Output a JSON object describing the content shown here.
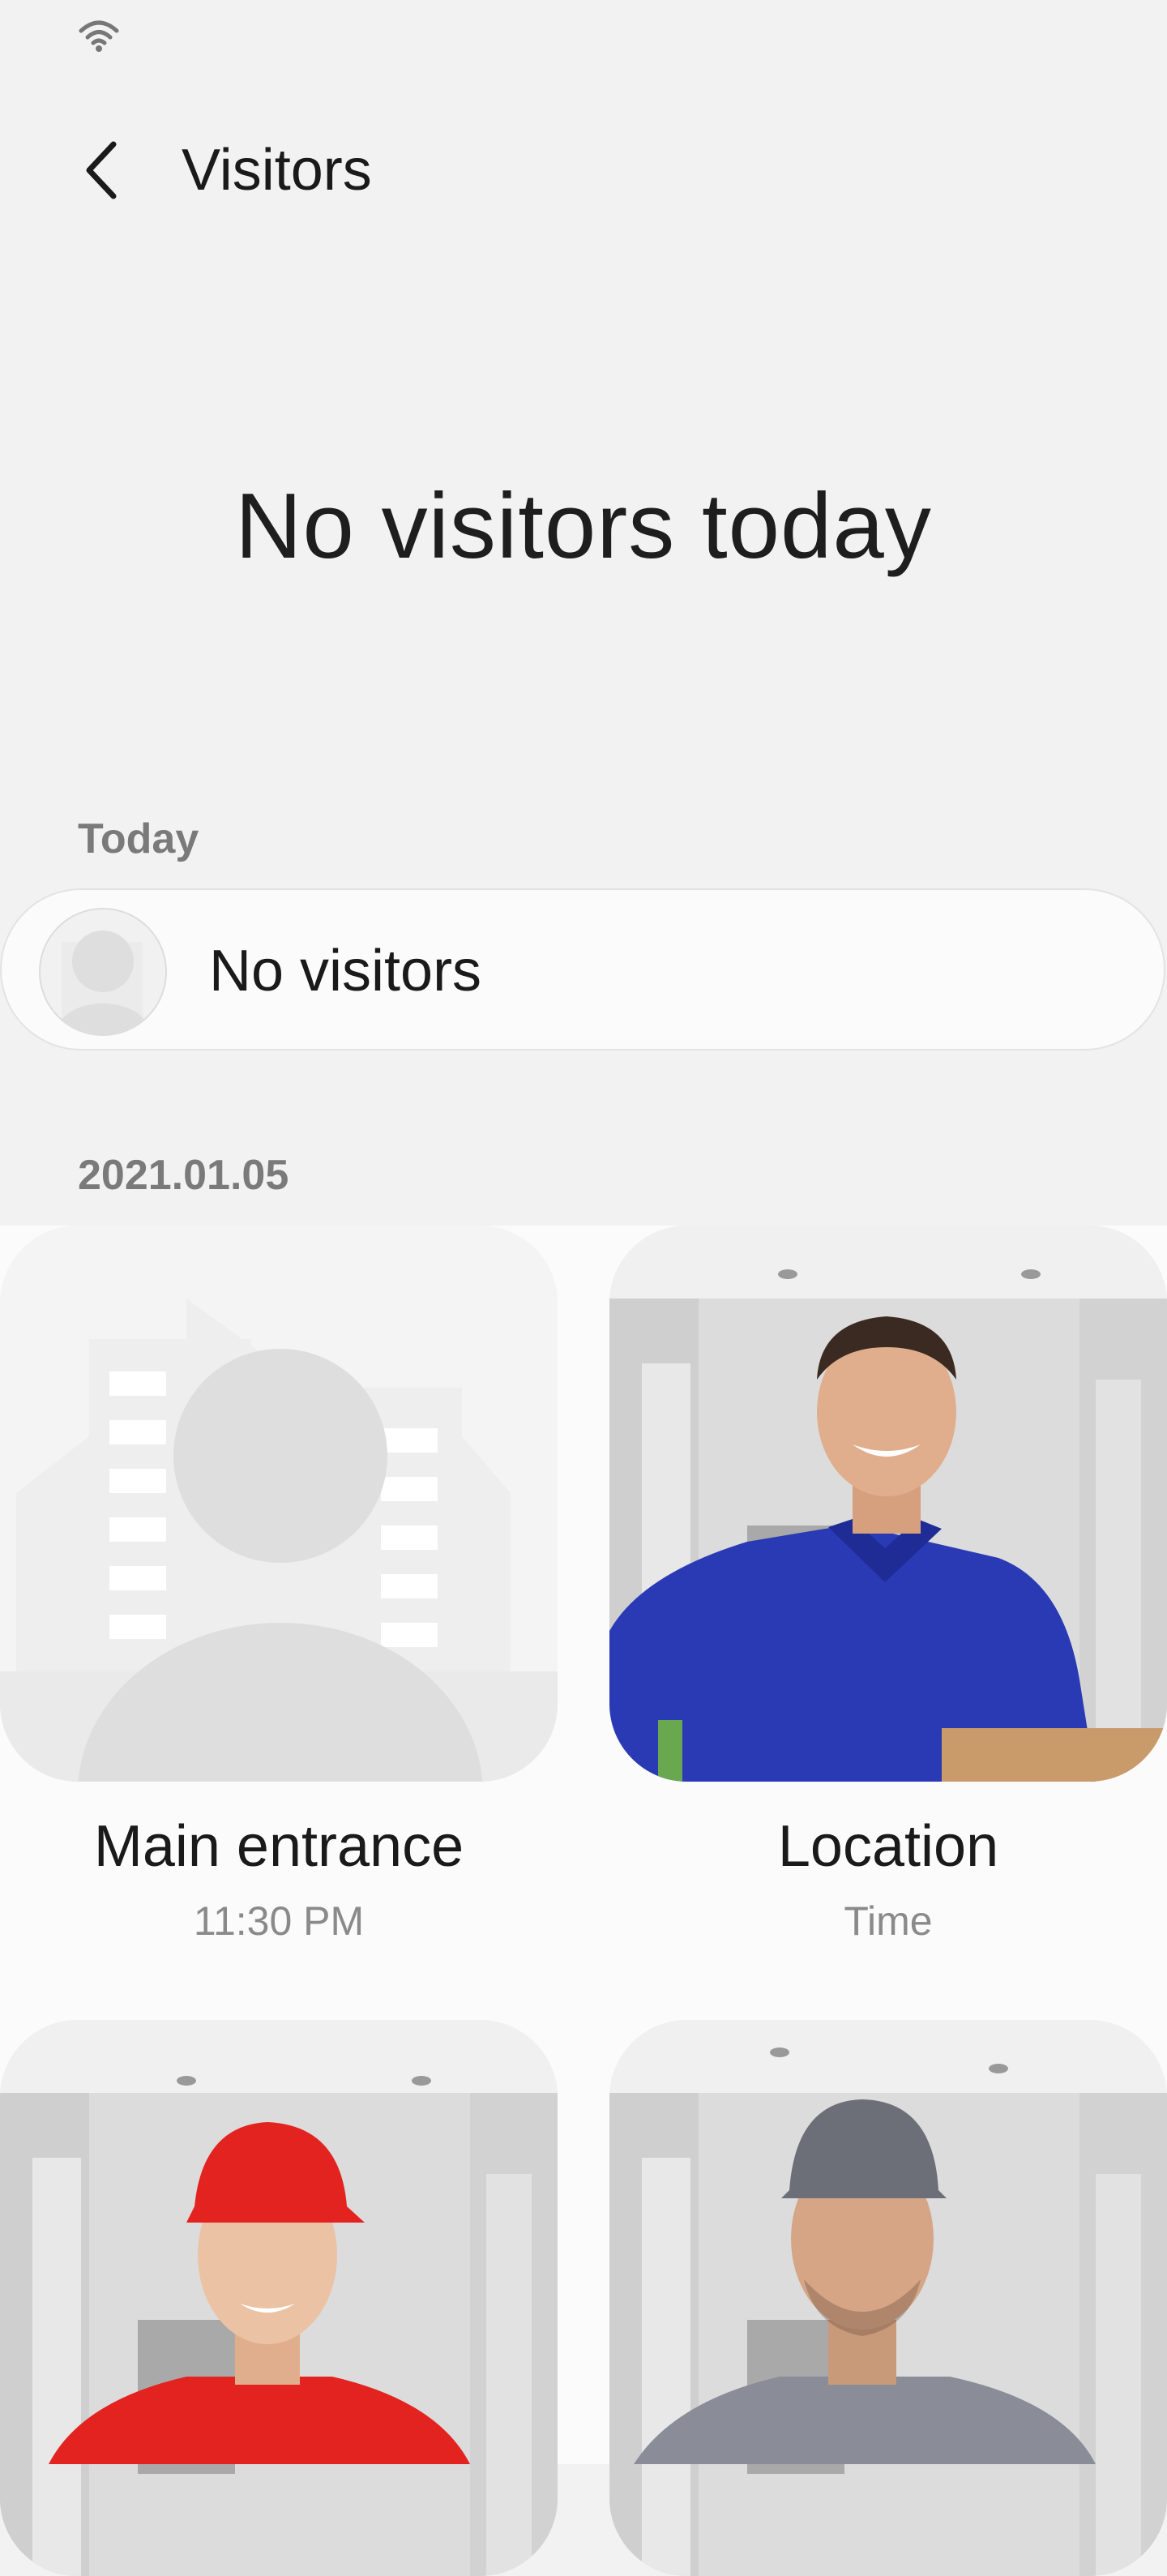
{
  "status_bar": {
    "wifi_icon": "wifi-icon"
  },
  "app_bar": {
    "back_icon": "chevron-left-icon",
    "title": "Visitors"
  },
  "hero": {
    "title": "No visitors today"
  },
  "today_section": {
    "header": "Today",
    "row": {
      "avatar_icon": "person-placeholder-icon",
      "label": "No visitors"
    }
  },
  "date_section": {
    "header": "2021.01.05",
    "cards": [
      {
        "location": "Main entrance",
        "time": "11:30 PM",
        "image": "placeholder-person-building-icon"
      },
      {
        "location": "Location",
        "time": "Time",
        "image": "visitor-photo-blue-polo"
      },
      {
        "location": "",
        "time": "",
        "image": "visitor-photo-red-cap"
      },
      {
        "location": "",
        "time": "",
        "image": "visitor-photo-grey-cap"
      }
    ]
  },
  "colors": {
    "background": "#f2f2f2",
    "card_background": "#fbfbfb",
    "section_header": "#7a7a7a",
    "time_text": "#8a8a8a",
    "polo_blue": "#2a3ab4",
    "cap_red": "#e32320",
    "shirt_grey": "#8a8c98"
  }
}
